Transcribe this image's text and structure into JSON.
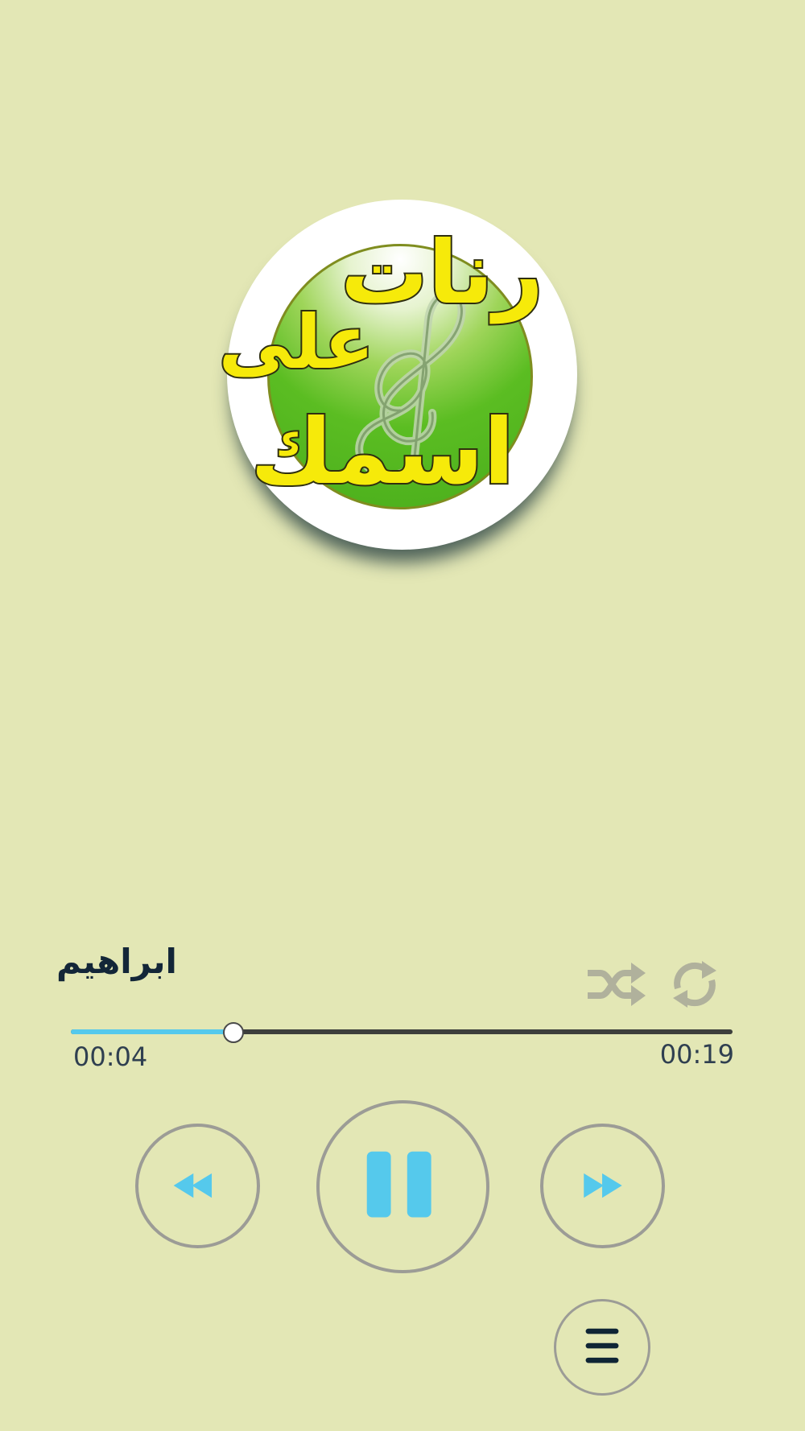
{
  "album_art": {
    "words": [
      "رنات",
      "على",
      "اسمك"
    ]
  },
  "track": {
    "title": "ابراهيم"
  },
  "playback": {
    "elapsed": "00:04",
    "total": "00:19",
    "progress_percent": 24.5
  },
  "colors": {
    "background": "#e3e7b5",
    "accent": "#55c9ec",
    "control_ring": "#9c9c96",
    "toggle_inactive": "#b0b19c",
    "logo_text": "#f6ea0a",
    "logo_disc": "#5bbd22"
  },
  "icons": {
    "shuffle": "shuffle-icon",
    "repeat": "repeat-icon",
    "previous": "rewind-icon",
    "pause": "pause-icon",
    "next": "fast-forward-icon",
    "menu": "menu-icon"
  }
}
